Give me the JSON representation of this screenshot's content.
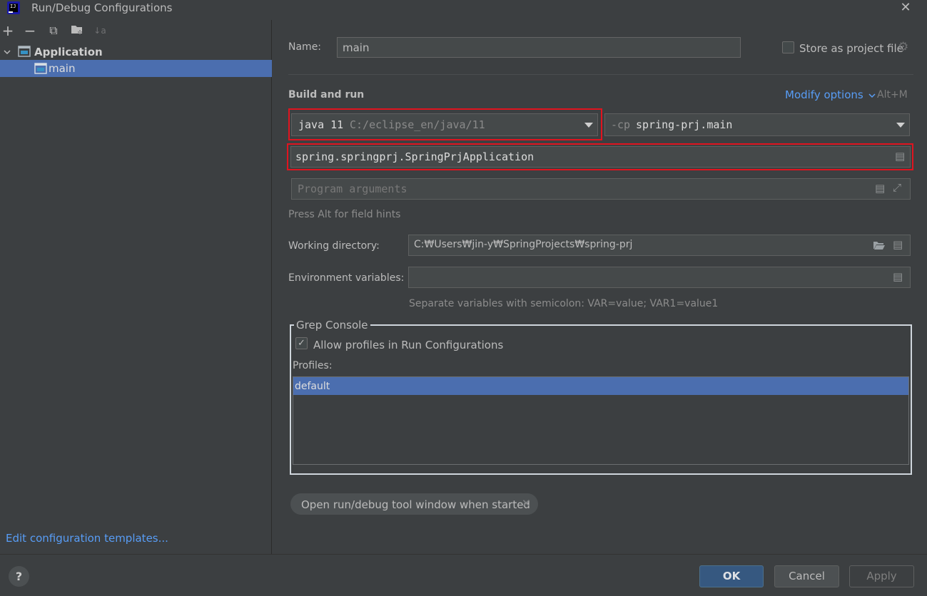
{
  "window": {
    "title": "Run/Debug Configurations",
    "app_icon_text": "IJ"
  },
  "toolbar": {
    "add": "+",
    "remove": "−",
    "copy": "⧉",
    "new_folder": "▣",
    "sort": "↓a"
  },
  "tree": {
    "group_label": "Application",
    "item_label": "main"
  },
  "left_footer": {
    "edit_templates": "Edit configuration templates..."
  },
  "form": {
    "name_label": "Name:",
    "name_value": "main",
    "store_label": "Store as project file",
    "store_checked": false,
    "section_title": "Build and run",
    "modify_options": "Modify options",
    "modify_shortcut": "Alt+M",
    "jre_name": "java 11",
    "jre_path": "C:/eclipse_en/java/11",
    "cp_flag": "-cp",
    "cp_value": "spring-prj.main",
    "main_class": "spring.springprj.SpringPrjApplication",
    "program_args_placeholder": "Program arguments",
    "field_hint": "Press Alt for field hints",
    "workdir_label": "Working directory:",
    "workdir_value": "C:₩Users₩jin-y₩SpringProjects₩spring-prj",
    "env_label": "Environment variables:",
    "env_value": "",
    "env_hint": "Separate variables with semicolon: VAR=value; VAR1=value1"
  },
  "grep": {
    "title": "Grep Console",
    "allow_label": "Allow profiles in Run Configurations",
    "allow_checked": true,
    "profiles_label": "Profiles:",
    "profiles": [
      "default"
    ]
  },
  "chip": {
    "label": "Open run/debug tool window when started",
    "close": "✕"
  },
  "buttons": {
    "help": "?",
    "ok": "OK",
    "cancel": "Cancel",
    "apply": "Apply"
  },
  "colors": {
    "background": "#3c3f41",
    "selection": "#4b6eaf",
    "link": "#589df6",
    "highlight_box": "#e0141f",
    "primary_button": "#365880"
  }
}
